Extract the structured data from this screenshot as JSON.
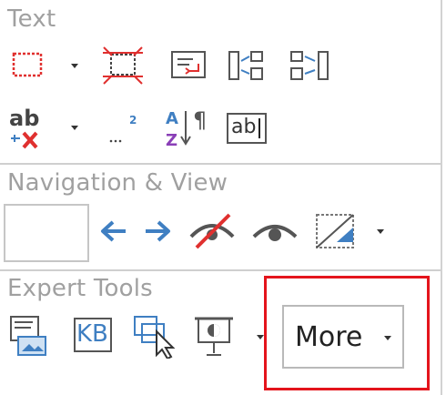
{
  "sections": {
    "text": {
      "title": "Text"
    },
    "navigation": {
      "title": "Navigation & View"
    },
    "expert": {
      "title": "Expert Tools"
    }
  },
  "text_tools": {
    "ab_label": "ab",
    "tag_glyph": "¶",
    "ab_field_label": "ab"
  },
  "expert_tools": {
    "kb_label": "KB",
    "more_label": "More"
  },
  "colors": {
    "accent_red": "#e4141c",
    "icon_blue": "#3f7fc2",
    "icon_gray": "#5b5b5b",
    "section_gray": "#a0a0a0"
  }
}
